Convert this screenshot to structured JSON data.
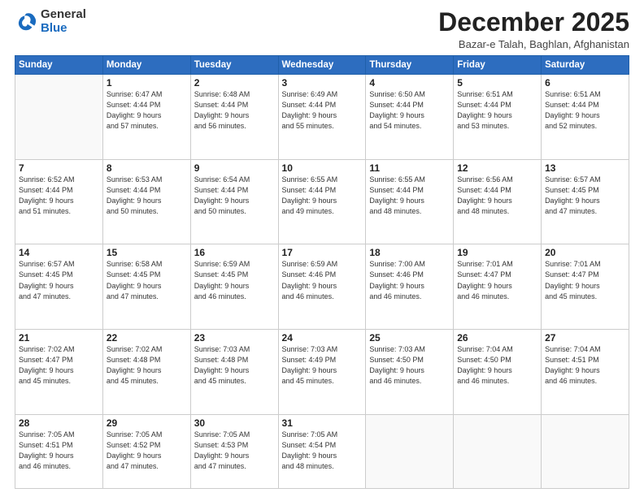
{
  "header": {
    "logo_general": "General",
    "logo_blue": "Blue",
    "month_title": "December 2025",
    "location": "Bazar-e Talah, Baghlan, Afghanistan"
  },
  "days_of_week": [
    "Sunday",
    "Monday",
    "Tuesday",
    "Wednesday",
    "Thursday",
    "Friday",
    "Saturday"
  ],
  "weeks": [
    [
      {
        "day": "",
        "info": ""
      },
      {
        "day": "1",
        "info": "Sunrise: 6:47 AM\nSunset: 4:44 PM\nDaylight: 9 hours\nand 57 minutes."
      },
      {
        "day": "2",
        "info": "Sunrise: 6:48 AM\nSunset: 4:44 PM\nDaylight: 9 hours\nand 56 minutes."
      },
      {
        "day": "3",
        "info": "Sunrise: 6:49 AM\nSunset: 4:44 PM\nDaylight: 9 hours\nand 55 minutes."
      },
      {
        "day": "4",
        "info": "Sunrise: 6:50 AM\nSunset: 4:44 PM\nDaylight: 9 hours\nand 54 minutes."
      },
      {
        "day": "5",
        "info": "Sunrise: 6:51 AM\nSunset: 4:44 PM\nDaylight: 9 hours\nand 53 minutes."
      },
      {
        "day": "6",
        "info": "Sunrise: 6:51 AM\nSunset: 4:44 PM\nDaylight: 9 hours\nand 52 minutes."
      }
    ],
    [
      {
        "day": "7",
        "info": "Sunrise: 6:52 AM\nSunset: 4:44 PM\nDaylight: 9 hours\nand 51 minutes."
      },
      {
        "day": "8",
        "info": "Sunrise: 6:53 AM\nSunset: 4:44 PM\nDaylight: 9 hours\nand 50 minutes."
      },
      {
        "day": "9",
        "info": "Sunrise: 6:54 AM\nSunset: 4:44 PM\nDaylight: 9 hours\nand 50 minutes."
      },
      {
        "day": "10",
        "info": "Sunrise: 6:55 AM\nSunset: 4:44 PM\nDaylight: 9 hours\nand 49 minutes."
      },
      {
        "day": "11",
        "info": "Sunrise: 6:55 AM\nSunset: 4:44 PM\nDaylight: 9 hours\nand 48 minutes."
      },
      {
        "day": "12",
        "info": "Sunrise: 6:56 AM\nSunset: 4:44 PM\nDaylight: 9 hours\nand 48 minutes."
      },
      {
        "day": "13",
        "info": "Sunrise: 6:57 AM\nSunset: 4:45 PM\nDaylight: 9 hours\nand 47 minutes."
      }
    ],
    [
      {
        "day": "14",
        "info": "Sunrise: 6:57 AM\nSunset: 4:45 PM\nDaylight: 9 hours\nand 47 minutes."
      },
      {
        "day": "15",
        "info": "Sunrise: 6:58 AM\nSunset: 4:45 PM\nDaylight: 9 hours\nand 47 minutes."
      },
      {
        "day": "16",
        "info": "Sunrise: 6:59 AM\nSunset: 4:45 PM\nDaylight: 9 hours\nand 46 minutes."
      },
      {
        "day": "17",
        "info": "Sunrise: 6:59 AM\nSunset: 4:46 PM\nDaylight: 9 hours\nand 46 minutes."
      },
      {
        "day": "18",
        "info": "Sunrise: 7:00 AM\nSunset: 4:46 PM\nDaylight: 9 hours\nand 46 minutes."
      },
      {
        "day": "19",
        "info": "Sunrise: 7:01 AM\nSunset: 4:47 PM\nDaylight: 9 hours\nand 46 minutes."
      },
      {
        "day": "20",
        "info": "Sunrise: 7:01 AM\nSunset: 4:47 PM\nDaylight: 9 hours\nand 45 minutes."
      }
    ],
    [
      {
        "day": "21",
        "info": "Sunrise: 7:02 AM\nSunset: 4:47 PM\nDaylight: 9 hours\nand 45 minutes."
      },
      {
        "day": "22",
        "info": "Sunrise: 7:02 AM\nSunset: 4:48 PM\nDaylight: 9 hours\nand 45 minutes."
      },
      {
        "day": "23",
        "info": "Sunrise: 7:03 AM\nSunset: 4:48 PM\nDaylight: 9 hours\nand 45 minutes."
      },
      {
        "day": "24",
        "info": "Sunrise: 7:03 AM\nSunset: 4:49 PM\nDaylight: 9 hours\nand 45 minutes."
      },
      {
        "day": "25",
        "info": "Sunrise: 7:03 AM\nSunset: 4:50 PM\nDaylight: 9 hours\nand 46 minutes."
      },
      {
        "day": "26",
        "info": "Sunrise: 7:04 AM\nSunset: 4:50 PM\nDaylight: 9 hours\nand 46 minutes."
      },
      {
        "day": "27",
        "info": "Sunrise: 7:04 AM\nSunset: 4:51 PM\nDaylight: 9 hours\nand 46 minutes."
      }
    ],
    [
      {
        "day": "28",
        "info": "Sunrise: 7:05 AM\nSunset: 4:51 PM\nDaylight: 9 hours\nand 46 minutes."
      },
      {
        "day": "29",
        "info": "Sunrise: 7:05 AM\nSunset: 4:52 PM\nDaylight: 9 hours\nand 47 minutes."
      },
      {
        "day": "30",
        "info": "Sunrise: 7:05 AM\nSunset: 4:53 PM\nDaylight: 9 hours\nand 47 minutes."
      },
      {
        "day": "31",
        "info": "Sunrise: 7:05 AM\nSunset: 4:54 PM\nDaylight: 9 hours\nand 48 minutes."
      },
      {
        "day": "",
        "info": ""
      },
      {
        "day": "",
        "info": ""
      },
      {
        "day": "",
        "info": ""
      }
    ]
  ]
}
